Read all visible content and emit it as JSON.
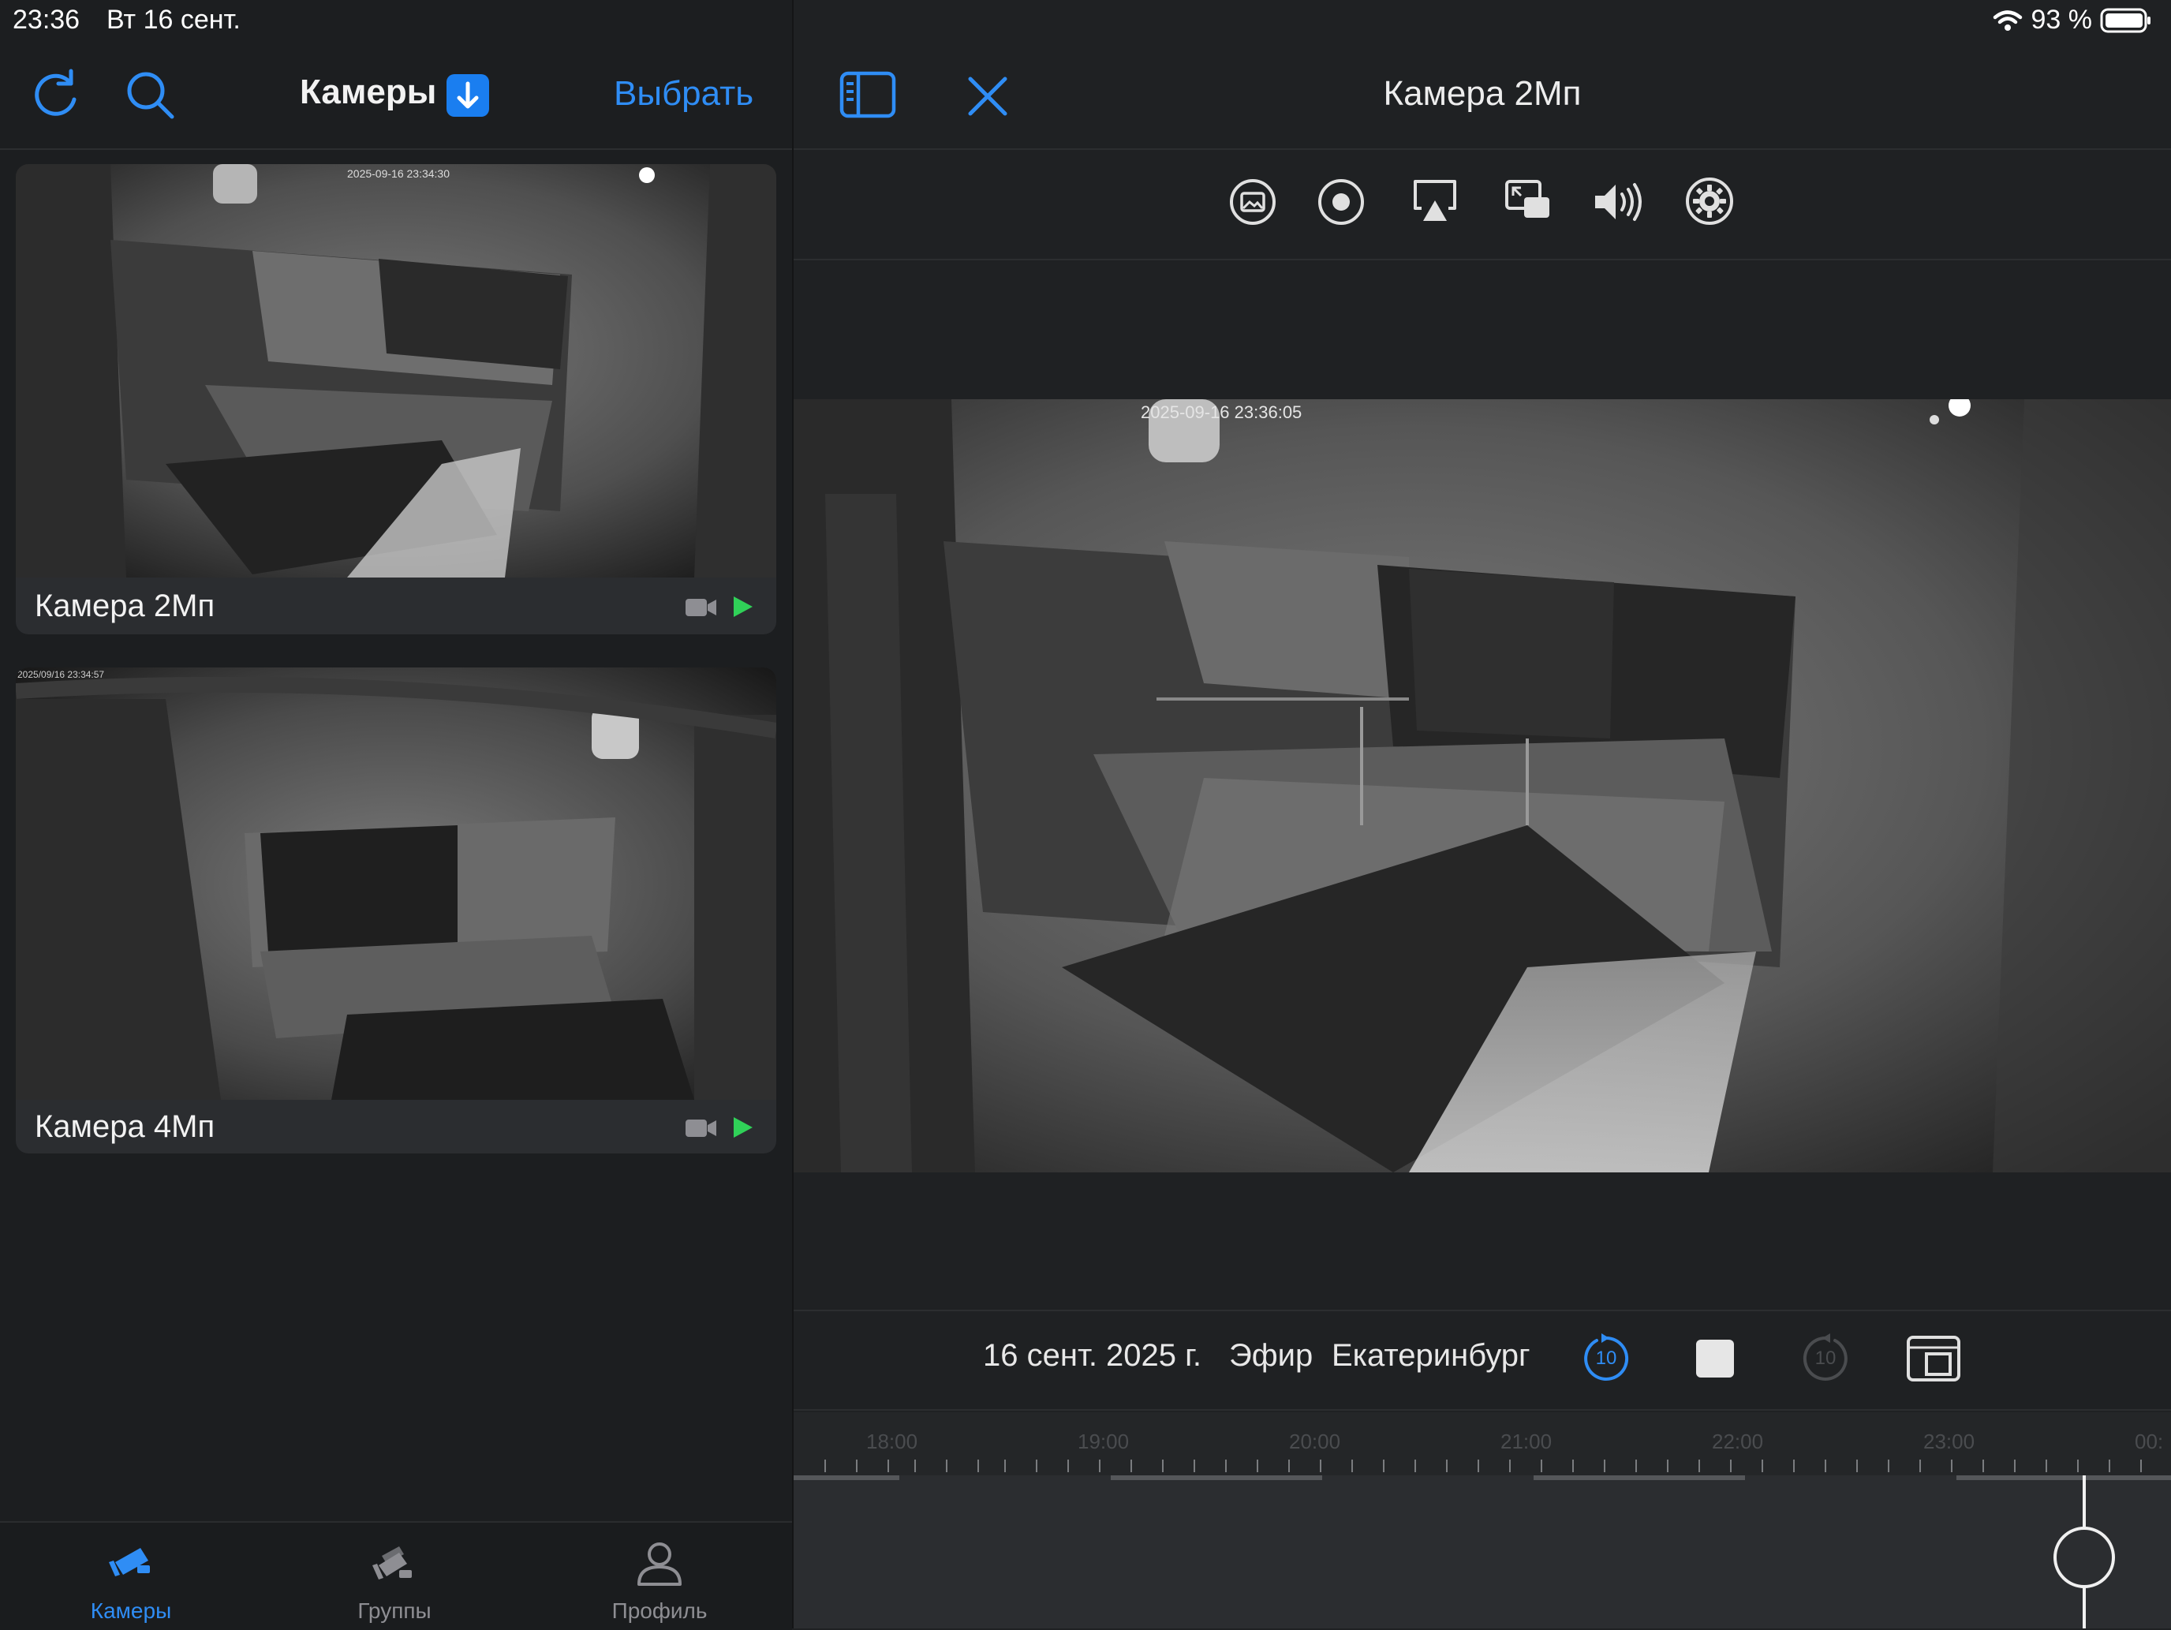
{
  "status": {
    "time": "23:36",
    "date": "Вт 16 сент.",
    "battery_text": "93 %"
  },
  "left": {
    "title": "Камеры",
    "select_label": "Выбрать",
    "cameras": [
      {
        "name": "Камера 2Мп",
        "timestamp": "2025-09-16 23:34:30"
      },
      {
        "name": "Камера 4Мп",
        "timestamp": "2025/09/16 23:34:57"
      }
    ]
  },
  "tabs": [
    {
      "label": "Камеры",
      "active": true
    },
    {
      "label": "Группы",
      "active": false
    },
    {
      "label": "Профиль",
      "active": false
    }
  ],
  "right": {
    "title": "Камера 2Мп",
    "video_timestamp": "2025-09-16  23:36:05",
    "toolbar_icons": [
      "snapshot-icon",
      "record-icon",
      "airplay-icon",
      "pip-icon",
      "volume-icon",
      "settings-icon"
    ],
    "info": {
      "date": "16 сент. 2025 г.",
      "mode": "Эфир",
      "timezone": "Екатеринбург",
      "skip_back": "10",
      "skip_forward": "10"
    },
    "timeline_hours": [
      "18:00",
      "19:00",
      "20:00",
      "21:00",
      "22:00",
      "23:00",
      "00:"
    ]
  },
  "colors": {
    "accent": "#2f8df5",
    "play_green": "#30d158",
    "background": "#1f2123"
  }
}
